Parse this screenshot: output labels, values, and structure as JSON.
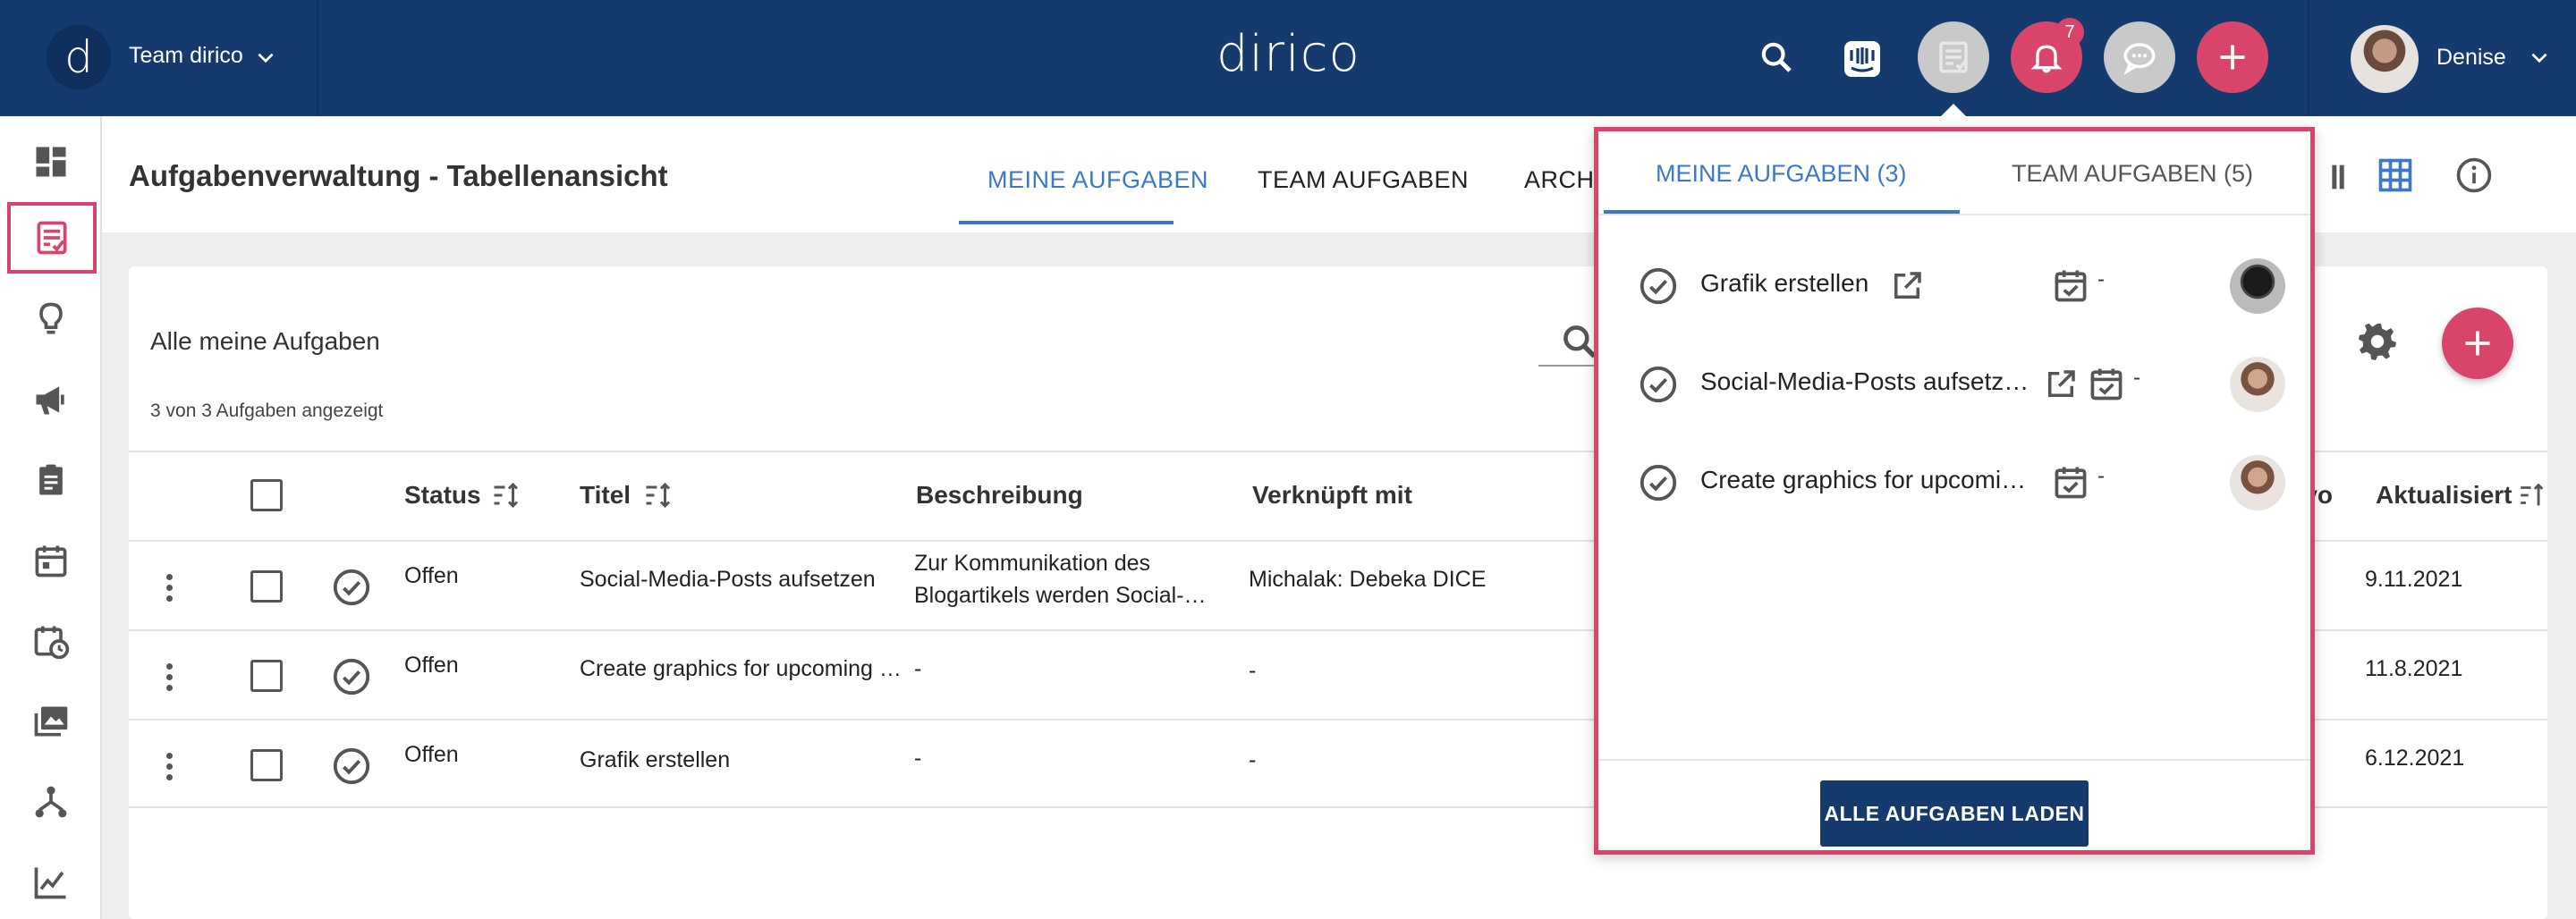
{
  "header": {
    "logo_letter": "d",
    "team_name": "Team dirico",
    "brand": "dirico",
    "notification_count": "7",
    "user_name": "Denise"
  },
  "page": {
    "title": "Aufgabenverwaltung - Tabellenansicht",
    "tabs": [
      "MEINE AUFGABEN",
      "TEAM AUFGABEN",
      "ARCH"
    ]
  },
  "card": {
    "title": "Alle meine Aufgaben",
    "subtitle": "3 von 3 Aufgaben angezeigt"
  },
  "table": {
    "columns": [
      "Status",
      "Titel",
      "Beschreibung",
      "Verknüpft mit",
      "rt vo",
      "Aktualisiert"
    ],
    "rows": [
      {
        "status": "Offen",
        "title": "Social-Media-Posts aufsetzen",
        "desc_line1": "Zur Kommunikation des",
        "desc_line2": "Blogartikels werden Social-…",
        "linked": "Michalak: Debeka DICE",
        "updated": "9.11.2021"
      },
      {
        "status": "Offen",
        "title": "Create graphics for upcoming …",
        "desc_line1": "-",
        "desc_line2": "",
        "linked": "-",
        "updated": "11.8.2021"
      },
      {
        "status": "Offen",
        "title": "Grafik erstellen",
        "desc_line1": "-",
        "desc_line2": "",
        "linked": "-",
        "updated": "6.12.2021"
      }
    ]
  },
  "popup": {
    "tab_mine": "MEINE AUFGABEN (3)",
    "tab_team": "TEAM AUFGABEN (5)",
    "tasks": [
      {
        "title": "Grafik erstellen",
        "date": "-"
      },
      {
        "title": "Social-Media-Posts aufsetz…",
        "date": "-"
      },
      {
        "title": "Create graphics for upcomi…",
        "date": "-"
      }
    ],
    "load_button": "ALLE AUFGABEN LADEN"
  },
  "colors": {
    "header_bg": "#143a6e",
    "accent": "#d9456a",
    "tab_active": "#3d78c7"
  }
}
